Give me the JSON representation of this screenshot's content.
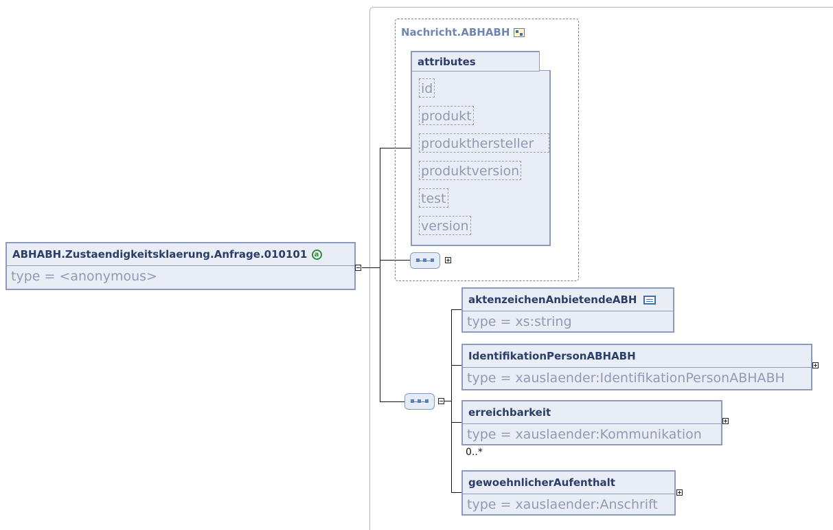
{
  "root": {
    "name": "ABHABH.Zustaendigkeitsklaerung.Anfrage.010101",
    "type": "type = <anonymous>"
  },
  "group": {
    "title": "Nachricht.ABHABH",
    "attributes_header": "attributes",
    "attributes": [
      "id",
      "produkt",
      "produkthersteller",
      "produktversion",
      "test",
      "version"
    ]
  },
  "elements": [
    {
      "name": "aktenzeichenAnbietendeABH",
      "type": "type = xs:string",
      "occurs": ""
    },
    {
      "name": "IdentifikationPersonABHABH",
      "type": "type = xauslaender:IdentifikationPersonABHABH",
      "occurs": ""
    },
    {
      "name": "erreichbarkeit",
      "type": "type = xauslaender:Kommunikation",
      "occurs": "0..*"
    },
    {
      "name": "gewoehnlicherAufenthalt",
      "type": "type = xauslaender:Anschrift",
      "occurs": ""
    }
  ],
  "icons": {
    "root_badge": "anonymous-type-icon",
    "group_badge": "complex-type-icon",
    "element_badge": "simple-type-icon"
  },
  "colors": {
    "box_fill": "#e9edf5",
    "box_border": "#8c9bbd",
    "header_text": "#2c3e68",
    "type_text": "#8f9bb4",
    "badge_green": "#2e8b3a"
  }
}
